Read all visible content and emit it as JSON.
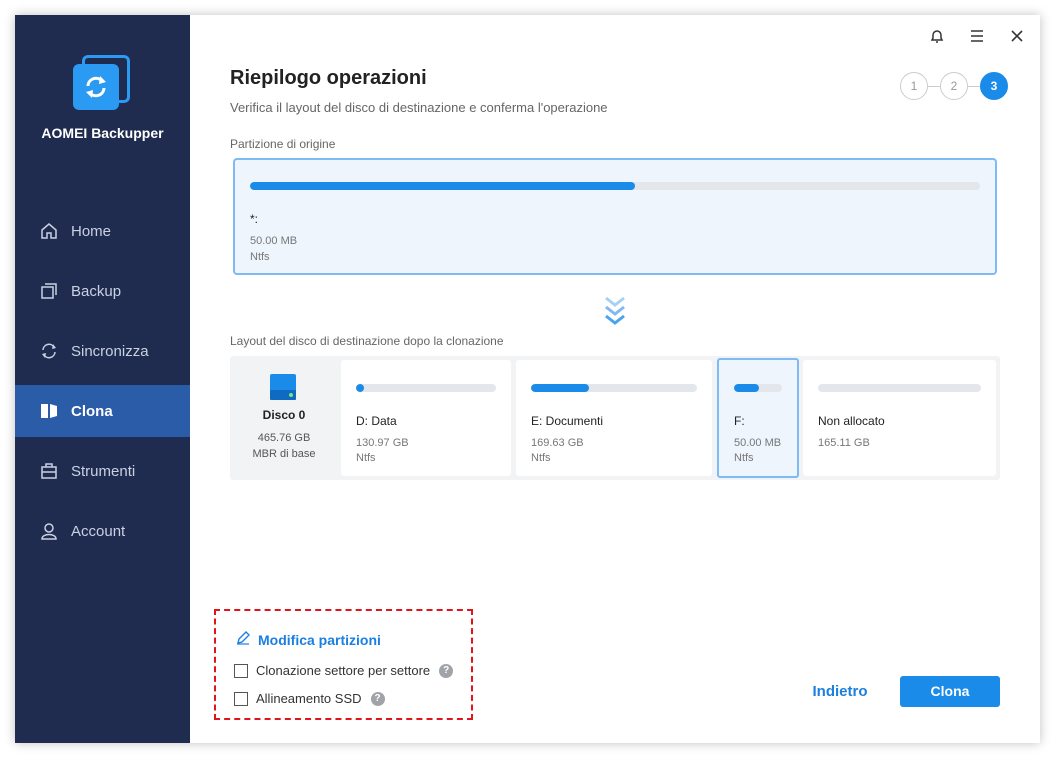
{
  "app": {
    "name": "AOMEI Backupper"
  },
  "sidebar": {
    "items": [
      {
        "label": "Home",
        "icon": "home-icon",
        "active": false
      },
      {
        "label": "Backup",
        "icon": "backup-icon",
        "active": false
      },
      {
        "label": "Sincronizza",
        "icon": "sync-icon",
        "active": false
      },
      {
        "label": "Clona",
        "icon": "clone-icon",
        "active": true
      },
      {
        "label": "Strumenti",
        "icon": "toolbox-icon",
        "active": false
      },
      {
        "label": "Account",
        "icon": "user-icon",
        "active": false
      }
    ]
  },
  "topbar": {
    "icons": [
      "bell-icon",
      "menu-icon",
      "close-icon"
    ]
  },
  "header": {
    "title": "Riepilogo operazioni",
    "subtitle": "Verifica il layout del disco di destinazione e conferma l'operazione"
  },
  "steps": {
    "labels": [
      "1",
      "2",
      "3"
    ],
    "current": 3
  },
  "source": {
    "label": "Partizione di origine",
    "name": "*:",
    "size": "50.00 MB",
    "fs": "Ntfs",
    "used_fraction": 0.527
  },
  "destination": {
    "label": "Layout del disco di destinazione dopo la clonazione",
    "disk": {
      "name": "Disco 0",
      "size": "465.76 GB",
      "type": "MBR di base"
    },
    "partitions": [
      {
        "name": "D: Data",
        "size": "130.97 GB",
        "fs": "Ntfs",
        "used_fraction": 0.05,
        "selected": false
      },
      {
        "name": "E: Documenti",
        "size": "169.63 GB",
        "fs": "Ntfs",
        "used_fraction": 0.35,
        "selected": false
      },
      {
        "name": "F:",
        "size": "50.00 MB",
        "fs": "Ntfs",
        "used_fraction": 0.53,
        "selected": true
      },
      {
        "name": "Non allocato",
        "size": "165.11 GB",
        "fs": "",
        "used_fraction": 0,
        "selected": false
      }
    ]
  },
  "options": {
    "edit_label": "Modifica partizioni",
    "sector_label": "Clonazione settore per settore",
    "ssd_label": "Allineamento SSD",
    "help_glyph": "?"
  },
  "footer": {
    "back_label": "Indietro",
    "clone_label": "Clona"
  },
  "colors": {
    "sidebar": "#1f2c4f",
    "active": "#2a5ca8",
    "accent": "#1a8be8",
    "highlight": "#e0141b"
  }
}
